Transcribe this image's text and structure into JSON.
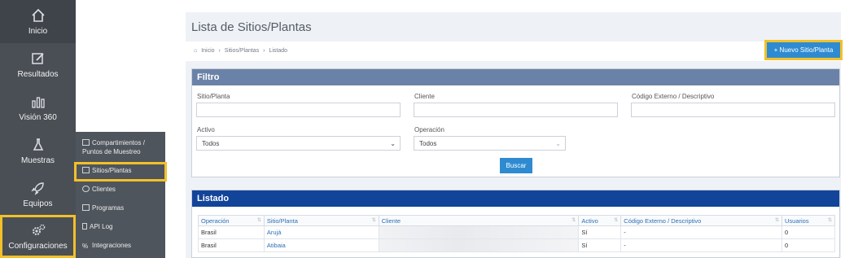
{
  "sidebar": {
    "items": [
      {
        "label": "Inicio",
        "icon": "home-icon"
      },
      {
        "label": "Resultados",
        "icon": "edit-icon"
      },
      {
        "label": "Visión 360",
        "icon": "bar-chart-icon"
      },
      {
        "label": "Muestras",
        "icon": "flask-icon"
      },
      {
        "label": "Equipos",
        "icon": "rocket-icon"
      },
      {
        "label": "Configuraciones",
        "icon": "gears-icon"
      }
    ]
  },
  "submenu": {
    "items": [
      {
        "label_line1": "Compartimientos /",
        "label_line2": "Puntos de Muestreo"
      },
      {
        "label_line1": "Sitios/Plantas"
      },
      {
        "label_line1": "Clientes"
      },
      {
        "label_line1": "Programas"
      },
      {
        "label_line1": "API Log"
      },
      {
        "label_line1": "Integraciones"
      }
    ]
  },
  "page": {
    "title": "Lista de Sitios/Plantas",
    "breadcrumb": [
      "Inicio",
      "Sitios/Plantas",
      "Listado"
    ],
    "new_button": "+ Nuevo Sitio/Planta"
  },
  "filter": {
    "title": "Filtro",
    "sitio_label": "Sitio/Planta",
    "cliente_label": "Cliente",
    "codigo_label": "Código Externo / Descriptivo",
    "activo_label": "Activo",
    "activo_value": "Todos",
    "operacion_label": "Operación",
    "operacion_value": "Todos",
    "search_button": "Buscar"
  },
  "listado": {
    "title": "Listado",
    "columns": [
      "Operación",
      "Sitio/Planta",
      "Cliente",
      "Activo",
      "Código Externo / Descriptivo",
      "Usuarios"
    ],
    "rows": [
      {
        "operacion": "Brasil",
        "sitio": "Arujá",
        "cliente": "",
        "activo": "Sí",
        "codigo": "-",
        "usuarios": "0"
      },
      {
        "operacion": "Brasil",
        "sitio": "Atibaia",
        "cliente": "",
        "activo": "Sí",
        "codigo": "-",
        "usuarios": "0"
      }
    ]
  },
  "colors": {
    "sidebar_bg": "#4a4f55",
    "highlight": "#f2c029",
    "primary": "#2e8bd1",
    "filter_head": "#6b82a8",
    "list_head": "#12449a"
  }
}
